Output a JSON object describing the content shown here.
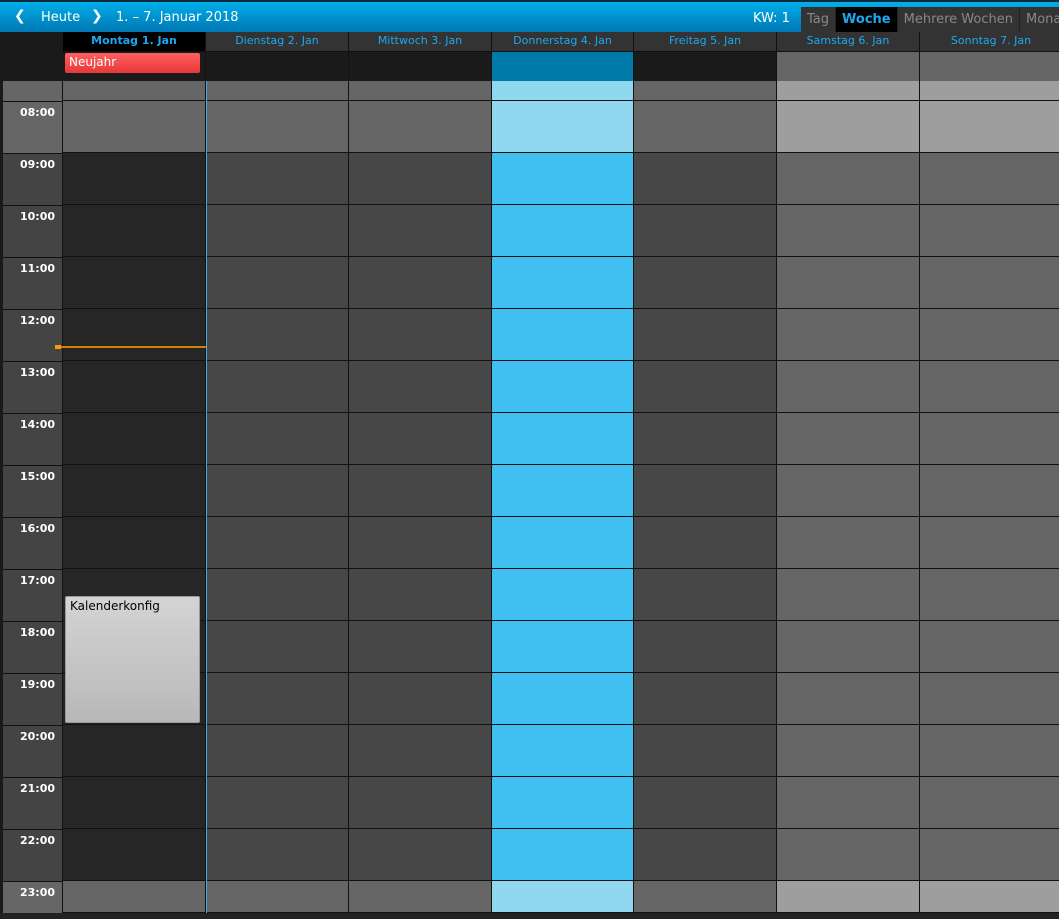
{
  "header": {
    "prev_icon": "chevron-left-icon",
    "today_label": "Heute",
    "next_icon": "chevron-right-icon",
    "range": "1. – 7. Januar 2018",
    "week_label": "KW: 1"
  },
  "views": [
    {
      "label": "Tag",
      "active": false
    },
    {
      "label": "Woche",
      "active": true
    },
    {
      "label": "Mehrere Wochen",
      "active": false
    },
    {
      "label": "Monat",
      "active": false
    }
  ],
  "days": [
    {
      "label": "Montag 1. Jan",
      "today": true
    },
    {
      "label": "Dienstag 2. Jan"
    },
    {
      "label": "Mittwoch 3. Jan"
    },
    {
      "label": "Donnerstag 4. Jan",
      "selected": true
    },
    {
      "label": "Freitag 5. Jan"
    },
    {
      "label": "Samstag 6. Jan",
      "weekend": true
    },
    {
      "label": "Sonntag 7. Jan",
      "weekend": true
    }
  ],
  "hours": [
    "08:00",
    "09:00",
    "10:00",
    "11:00",
    "12:00",
    "13:00",
    "14:00",
    "15:00",
    "16:00",
    "17:00",
    "18:00",
    "19:00",
    "20:00",
    "21:00",
    "22:00",
    "23:00"
  ],
  "events": {
    "allday": {
      "title": "Neujahr",
      "color": "#ff4a4a"
    },
    "timed": {
      "title": "Kalenderkonfig",
      "start": "17:30",
      "end": "20:00"
    }
  },
  "now": "12:30",
  "colors": {
    "accent": "#1ea8f0",
    "today_work": "#262626",
    "work": "#474747",
    "off": "#666666",
    "selected_work": "#40c0f0",
    "selected_off": "#90d8f0",
    "weekend_work": "#666666",
    "weekend_off": "#9e9e9e",
    "now_line": "#d08000"
  }
}
